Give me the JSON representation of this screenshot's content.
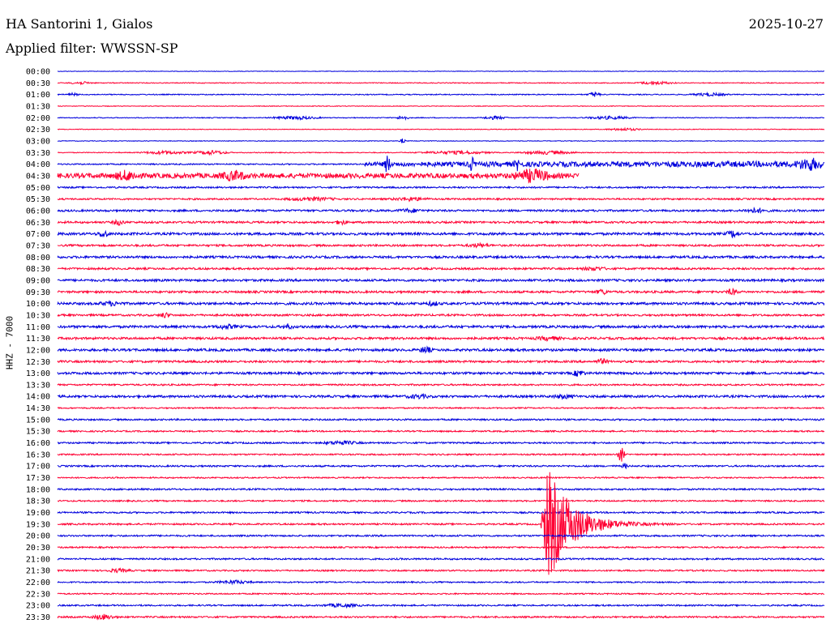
{
  "header": {
    "station_title": "HA Santorini 1, Gialos",
    "date": "2025-10-27",
    "filter_label": "Applied filter:",
    "filter_name": "WWSSN-SP"
  },
  "chart_data": {
    "type": "line",
    "title": "HA Santorini 1, Gialos",
    "subtitle": "Applied filter: WWSSN-SP",
    "ylabel": "HHZ - 7000",
    "xlabel": "",
    "grid": false,
    "colors": {
      "even_trace": "#0000dd",
      "odd_trace": "#ff0033",
      "background": "#ffffff",
      "text": "#000000"
    },
    "rows": [
      {
        "label": "00:00",
        "noise": 0.3,
        "color": "blue",
        "bursts": []
      },
      {
        "label": "00:30",
        "noise": 0.5,
        "color": "red",
        "bursts": [
          {
            "t": 0.78,
            "w": 0.03,
            "a": 2
          },
          {
            "t": 0.03,
            "w": 0.02,
            "a": 1.5
          }
        ]
      },
      {
        "label": "01:00",
        "noise": 0.6,
        "color": "blue",
        "bursts": [
          {
            "t": 0.7,
            "w": 0.01,
            "a": 3
          },
          {
            "t": 0.85,
            "w": 0.03,
            "a": 1.8
          },
          {
            "t": 0.02,
            "w": 0.01,
            "a": 1.5
          }
        ]
      },
      {
        "label": "01:30",
        "noise": 0.4,
        "color": "red",
        "bursts": []
      },
      {
        "label": "02:00",
        "noise": 0.5,
        "color": "blue",
        "bursts": [
          {
            "t": 0.31,
            "w": 0.04,
            "a": 2
          },
          {
            "t": 0.45,
            "w": 0.01,
            "a": 3
          },
          {
            "t": 0.57,
            "w": 0.02,
            "a": 2
          },
          {
            "t": 0.72,
            "w": 0.04,
            "a": 1.8
          }
        ]
      },
      {
        "label": "02:30",
        "noise": 0.4,
        "color": "red",
        "bursts": [
          {
            "t": 0.74,
            "w": 0.03,
            "a": 1.5
          }
        ]
      },
      {
        "label": "03:00",
        "noise": 0.4,
        "color": "blue",
        "bursts": [
          {
            "t": 0.45,
            "w": 0.005,
            "a": 3
          }
        ]
      },
      {
        "label": "03:30",
        "noise": 0.5,
        "color": "red",
        "bursts": [
          {
            "t": 0.14,
            "w": 0.04,
            "a": 2
          },
          {
            "t": 0.2,
            "w": 0.03,
            "a": 2.5
          },
          {
            "t": 0.52,
            "w": 0.06,
            "a": 2
          },
          {
            "t": 0.64,
            "w": 0.05,
            "a": 2
          }
        ]
      },
      {
        "label": "04:00",
        "noise": 0.8,
        "color": "blue",
        "bursts": [
          {
            "t": 0.43,
            "w": 0.005,
            "a": 11
          },
          {
            "t": 0.54,
            "w": 0.005,
            "a": 8
          },
          {
            "t": 0.6,
            "w": 0.005,
            "a": 6
          },
          {
            "t": 0.98,
            "w": 0.02,
            "a": 6
          }
        ],
        "ramp": {
          "from": 0.4,
          "to": 1.0,
          "a": 3
        }
      },
      {
        "label": "04:30",
        "noise": 3,
        "color": "red",
        "bursts": [
          {
            "t": 0.09,
            "w": 0.02,
            "a": 5
          },
          {
            "t": 0.23,
            "w": 0.02,
            "a": 5
          },
          {
            "t": 0.62,
            "w": 0.03,
            "a": 7
          }
        ],
        "stop": 0.68
      },
      {
        "label": "05:00",
        "noise": 1.0,
        "color": "blue",
        "bursts": []
      },
      {
        "label": "05:30",
        "noise": 1.0,
        "color": "red",
        "bursts": [
          {
            "t": 0.33,
            "w": 0.04,
            "a": 2
          },
          {
            "t": 0.46,
            "w": 0.03,
            "a": 2
          }
        ]
      },
      {
        "label": "06:00",
        "noise": 1.2,
        "color": "blue",
        "bursts": [
          {
            "t": 0.46,
            "w": 0.02,
            "a": 2
          },
          {
            "t": 0.91,
            "w": 0.02,
            "a": 2.5
          }
        ]
      },
      {
        "label": "06:30",
        "noise": 1.2,
        "color": "red",
        "bursts": [
          {
            "t": 0.08,
            "w": 0.01,
            "a": 3
          },
          {
            "t": 0.37,
            "w": 0.01,
            "a": 2.5
          }
        ]
      },
      {
        "label": "07:00",
        "noise": 1.5,
        "color": "blue",
        "bursts": [
          {
            "t": 0.06,
            "w": 0.01,
            "a": 4
          },
          {
            "t": 0.88,
            "w": 0.01,
            "a": 4
          }
        ]
      },
      {
        "label": "07:30",
        "noise": 1.2,
        "color": "red",
        "bursts": [
          {
            "t": 0.55,
            "w": 0.02,
            "a": 2
          }
        ]
      },
      {
        "label": "08:00",
        "noise": 1.4,
        "color": "blue",
        "bursts": []
      },
      {
        "label": "08:30",
        "noise": 1.2,
        "color": "red",
        "bursts": [
          {
            "t": 0.7,
            "w": 0.02,
            "a": 2
          }
        ]
      },
      {
        "label": "09:00",
        "noise": 1.4,
        "color": "blue",
        "bursts": []
      },
      {
        "label": "09:30",
        "noise": 1.3,
        "color": "red",
        "bursts": [
          {
            "t": 0.71,
            "w": 0.01,
            "a": 3
          },
          {
            "t": 0.88,
            "w": 0.01,
            "a": 3.5
          }
        ]
      },
      {
        "label": "10:00",
        "noise": 1.5,
        "color": "blue",
        "bursts": [
          {
            "t": 0.07,
            "w": 0.02,
            "a": 2
          },
          {
            "t": 0.49,
            "w": 0.01,
            "a": 2.5
          }
        ]
      },
      {
        "label": "10:30",
        "noise": 1.2,
        "color": "red",
        "bursts": [
          {
            "t": 0.14,
            "w": 0.01,
            "a": 3
          }
        ]
      },
      {
        "label": "11:00",
        "noise": 1.5,
        "color": "blue",
        "bursts": [
          {
            "t": 0.22,
            "w": 0.02,
            "a": 2
          },
          {
            "t": 0.3,
            "w": 0.01,
            "a": 2.5
          }
        ]
      },
      {
        "label": "11:30",
        "noise": 1.4,
        "color": "red",
        "bursts": [
          {
            "t": 0.64,
            "w": 0.02,
            "a": 2
          }
        ]
      },
      {
        "label": "12:00",
        "noise": 1.5,
        "color": "blue",
        "bursts": [
          {
            "t": 0.48,
            "w": 0.01,
            "a": 4
          }
        ]
      },
      {
        "label": "12:30",
        "noise": 1.3,
        "color": "red",
        "bursts": [
          {
            "t": 0.71,
            "w": 0.01,
            "a": 3
          }
        ]
      },
      {
        "label": "13:00",
        "noise": 1.4,
        "color": "blue",
        "bursts": [
          {
            "t": 0.68,
            "w": 0.01,
            "a": 4
          }
        ]
      },
      {
        "label": "13:30",
        "noise": 1.0,
        "color": "red",
        "bursts": []
      },
      {
        "label": "14:00",
        "noise": 1.4,
        "color": "blue",
        "bursts": [
          {
            "t": 0.47,
            "w": 0.02,
            "a": 2
          },
          {
            "t": 0.66,
            "w": 0.02,
            "a": 2
          }
        ]
      },
      {
        "label": "14:30",
        "noise": 0.8,
        "color": "red",
        "bursts": []
      },
      {
        "label": "15:00",
        "noise": 1.0,
        "color": "blue",
        "bursts": []
      },
      {
        "label": "15:30",
        "noise": 0.9,
        "color": "red",
        "bursts": []
      },
      {
        "label": "16:00",
        "noise": 1.0,
        "color": "blue",
        "bursts": [
          {
            "t": 0.37,
            "w": 0.03,
            "a": 2
          }
        ]
      },
      {
        "label": "16:30",
        "noise": 0.9,
        "color": "red",
        "bursts": [
          {
            "t": 0.735,
            "w": 0.006,
            "a": 10
          }
        ]
      },
      {
        "label": "17:00",
        "noise": 1.0,
        "color": "blue",
        "bursts": [
          {
            "t": 0.74,
            "w": 0.005,
            "a": 3
          }
        ]
      },
      {
        "label": "17:30",
        "noise": 0.8,
        "color": "red",
        "bursts": []
      },
      {
        "label": "18:00",
        "noise": 1.0,
        "color": "blue",
        "bursts": []
      },
      {
        "label": "18:30",
        "noise": 0.9,
        "color": "red",
        "bursts": []
      },
      {
        "label": "19:00",
        "noise": 1.0,
        "color": "blue",
        "bursts": []
      },
      {
        "label": "19:30",
        "noise": 1.0,
        "color": "red",
        "bursts": [],
        "quake": {
          "t": 0.64,
          "w": 0.08,
          "a": 70
        }
      },
      {
        "label": "20:00",
        "noise": 1.0,
        "color": "blue",
        "bursts": []
      },
      {
        "label": "20:30",
        "noise": 0.9,
        "color": "red",
        "bursts": []
      },
      {
        "label": "21:00",
        "noise": 1.0,
        "color": "blue",
        "bursts": []
      },
      {
        "label": "21:30",
        "noise": 0.9,
        "color": "red",
        "bursts": [
          {
            "t": 0.08,
            "w": 0.02,
            "a": 2
          }
        ]
      },
      {
        "label": "22:00",
        "noise": 0.8,
        "color": "blue",
        "bursts": [
          {
            "t": 0.23,
            "w": 0.03,
            "a": 2
          }
        ]
      },
      {
        "label": "22:30",
        "noise": 0.8,
        "color": "red",
        "bursts": []
      },
      {
        "label": "23:00",
        "noise": 0.9,
        "color": "blue",
        "bursts": [
          {
            "t": 0.37,
            "w": 0.03,
            "a": 2
          }
        ]
      },
      {
        "label": "23:30",
        "noise": 1.0,
        "color": "red",
        "bursts": [
          {
            "t": 0.06,
            "w": 0.02,
            "a": 3
          }
        ]
      }
    ]
  }
}
